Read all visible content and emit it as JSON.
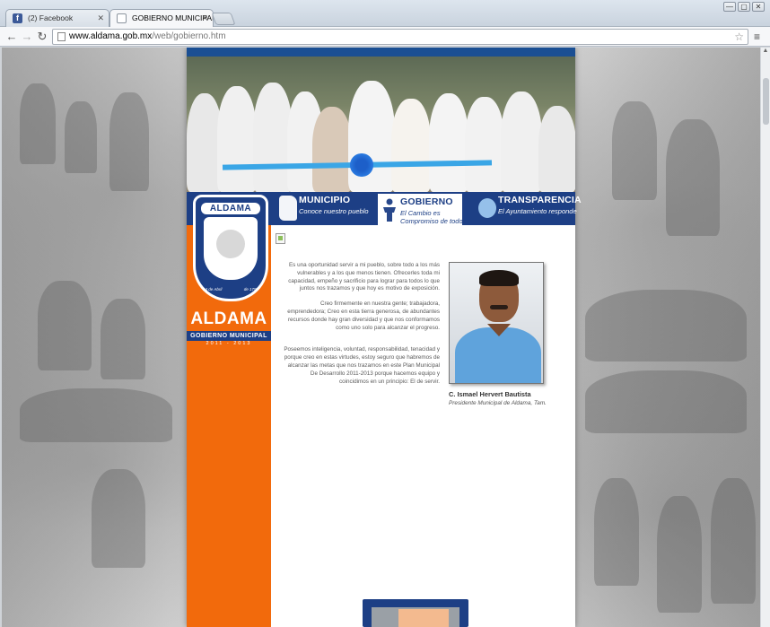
{
  "browser": {
    "tabs": [
      {
        "label": "(2) Facebook",
        "icon": "facebook-icon",
        "active": false
      },
      {
        "label": "GOBIERNO MUNICIPAL D",
        "icon": "page-icon",
        "active": true
      }
    ],
    "url_host": "www.aldama.gob.mx",
    "url_path": "/web/gobierno.htm",
    "window_buttons": [
      "—",
      "▢",
      "✕"
    ]
  },
  "site": {
    "nav": [
      {
        "title": "MUNICIPIO",
        "subtitle": "Conoce nuestro pueblo",
        "icon": "map-icon",
        "active": false
      },
      {
        "title": "GOBIERNO",
        "subtitle_line1": "El Cambio es",
        "subtitle_line2": "Compromiso de todos",
        "icon": "people-icon",
        "active": true
      },
      {
        "title": "TRANSPARENCIA",
        "subtitle": "El Ayuntamiento responde",
        "icon": "megaphone-icon",
        "active": false
      }
    ],
    "logo": {
      "shield_text": "ALDAMA",
      "shield_date_left": "24 de Abril",
      "shield_date_right": "de 1790",
      "name": "ALDAMA",
      "subtitle": "GOBIERNO MUNICIPAL",
      "years": "2011 - 2013"
    },
    "paragraphs": [
      "Es una oportunidad servir a mi pueblo, sobre todo a los más vulnerables y a los que menos tienen. Ofrecerles toda mi capacidad, empeño y sacrificio para lograr para todos lo que juntos nos trazamos y que hoy es motivo de exposición.",
      "Creo firmemente en nuestra gente; trabajadora, emprendedora; Creo en esta tierra generosa, de abundantes recursos donde hay gran diversidad y que nos conformamos como uno solo para alcanzar el progreso.",
      "Poseemos inteligencia, voluntad, responsabilidad, tenacidad y porque creo en estas virtudes, estoy seguro que habremos de alcanzar las metas que nos trazamos en este Plan Municipal De Desarrollo 2011-2013 porque hacemos equipo y coincidimos en un principio: El de servir."
    ],
    "official": {
      "name": "C. Ismael Hervert Bautista",
      "role": "Presidente Municipal de Aldama, Tam."
    },
    "colors": {
      "brand_blue": "#1d3f85",
      "brand_orange": "#f26a0c"
    }
  }
}
